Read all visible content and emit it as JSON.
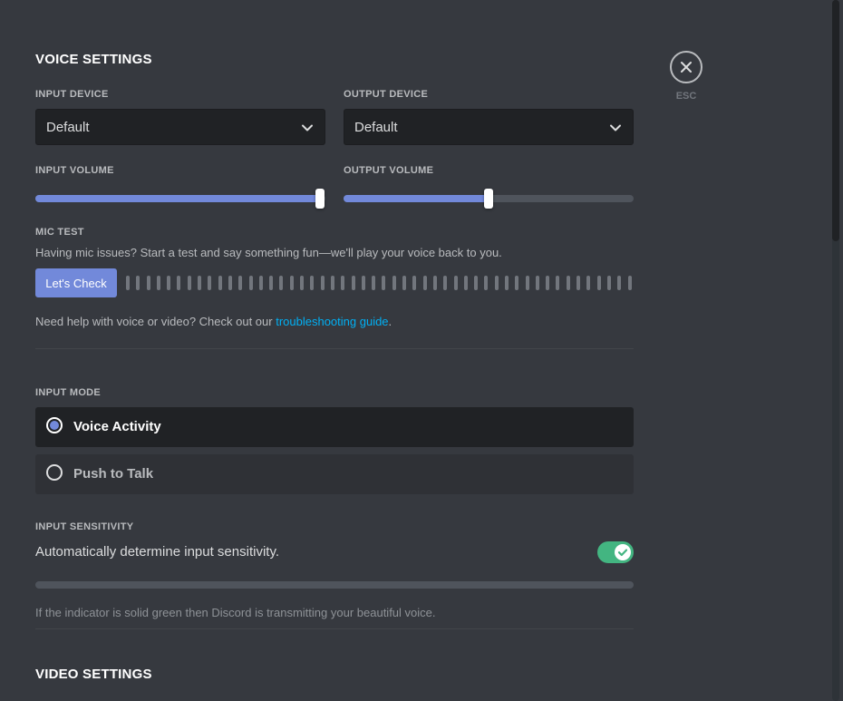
{
  "voice_settings": {
    "title": "VOICE SETTINGS",
    "input_device": {
      "label": "INPUT DEVICE",
      "value": "Default"
    },
    "output_device": {
      "label": "OUTPUT DEVICE",
      "value": "Default"
    },
    "input_volume": {
      "label": "INPUT VOLUME",
      "percent": 98
    },
    "output_volume": {
      "label": "OUTPUT VOLUME",
      "percent": 50
    }
  },
  "mic_test": {
    "label": "MIC TEST",
    "description": "Having mic issues? Start a test and say something fun—we'll play your voice back to you.",
    "button_label": "Let's Check",
    "help_prefix": "Need help with voice or video? Check out our ",
    "help_link": "troubleshooting guide",
    "help_suffix": "."
  },
  "input_mode": {
    "label": "INPUT MODE",
    "options": [
      {
        "label": "Voice Activity",
        "selected": true
      },
      {
        "label": "Push to Talk",
        "selected": false
      }
    ]
  },
  "input_sensitivity": {
    "label": "INPUT SENSITIVITY",
    "auto_label": "Automatically determine input sensitivity.",
    "auto_enabled": true,
    "note": "If the indicator is solid green then Discord is transmitting your beautiful voice."
  },
  "video_settings": {
    "title": "VIDEO SETTINGS"
  },
  "close": {
    "label": "ESC"
  },
  "colors": {
    "background": "#36393f",
    "accent": "#7289da",
    "toggle_on": "#43b581",
    "link": "#00b0f4"
  }
}
